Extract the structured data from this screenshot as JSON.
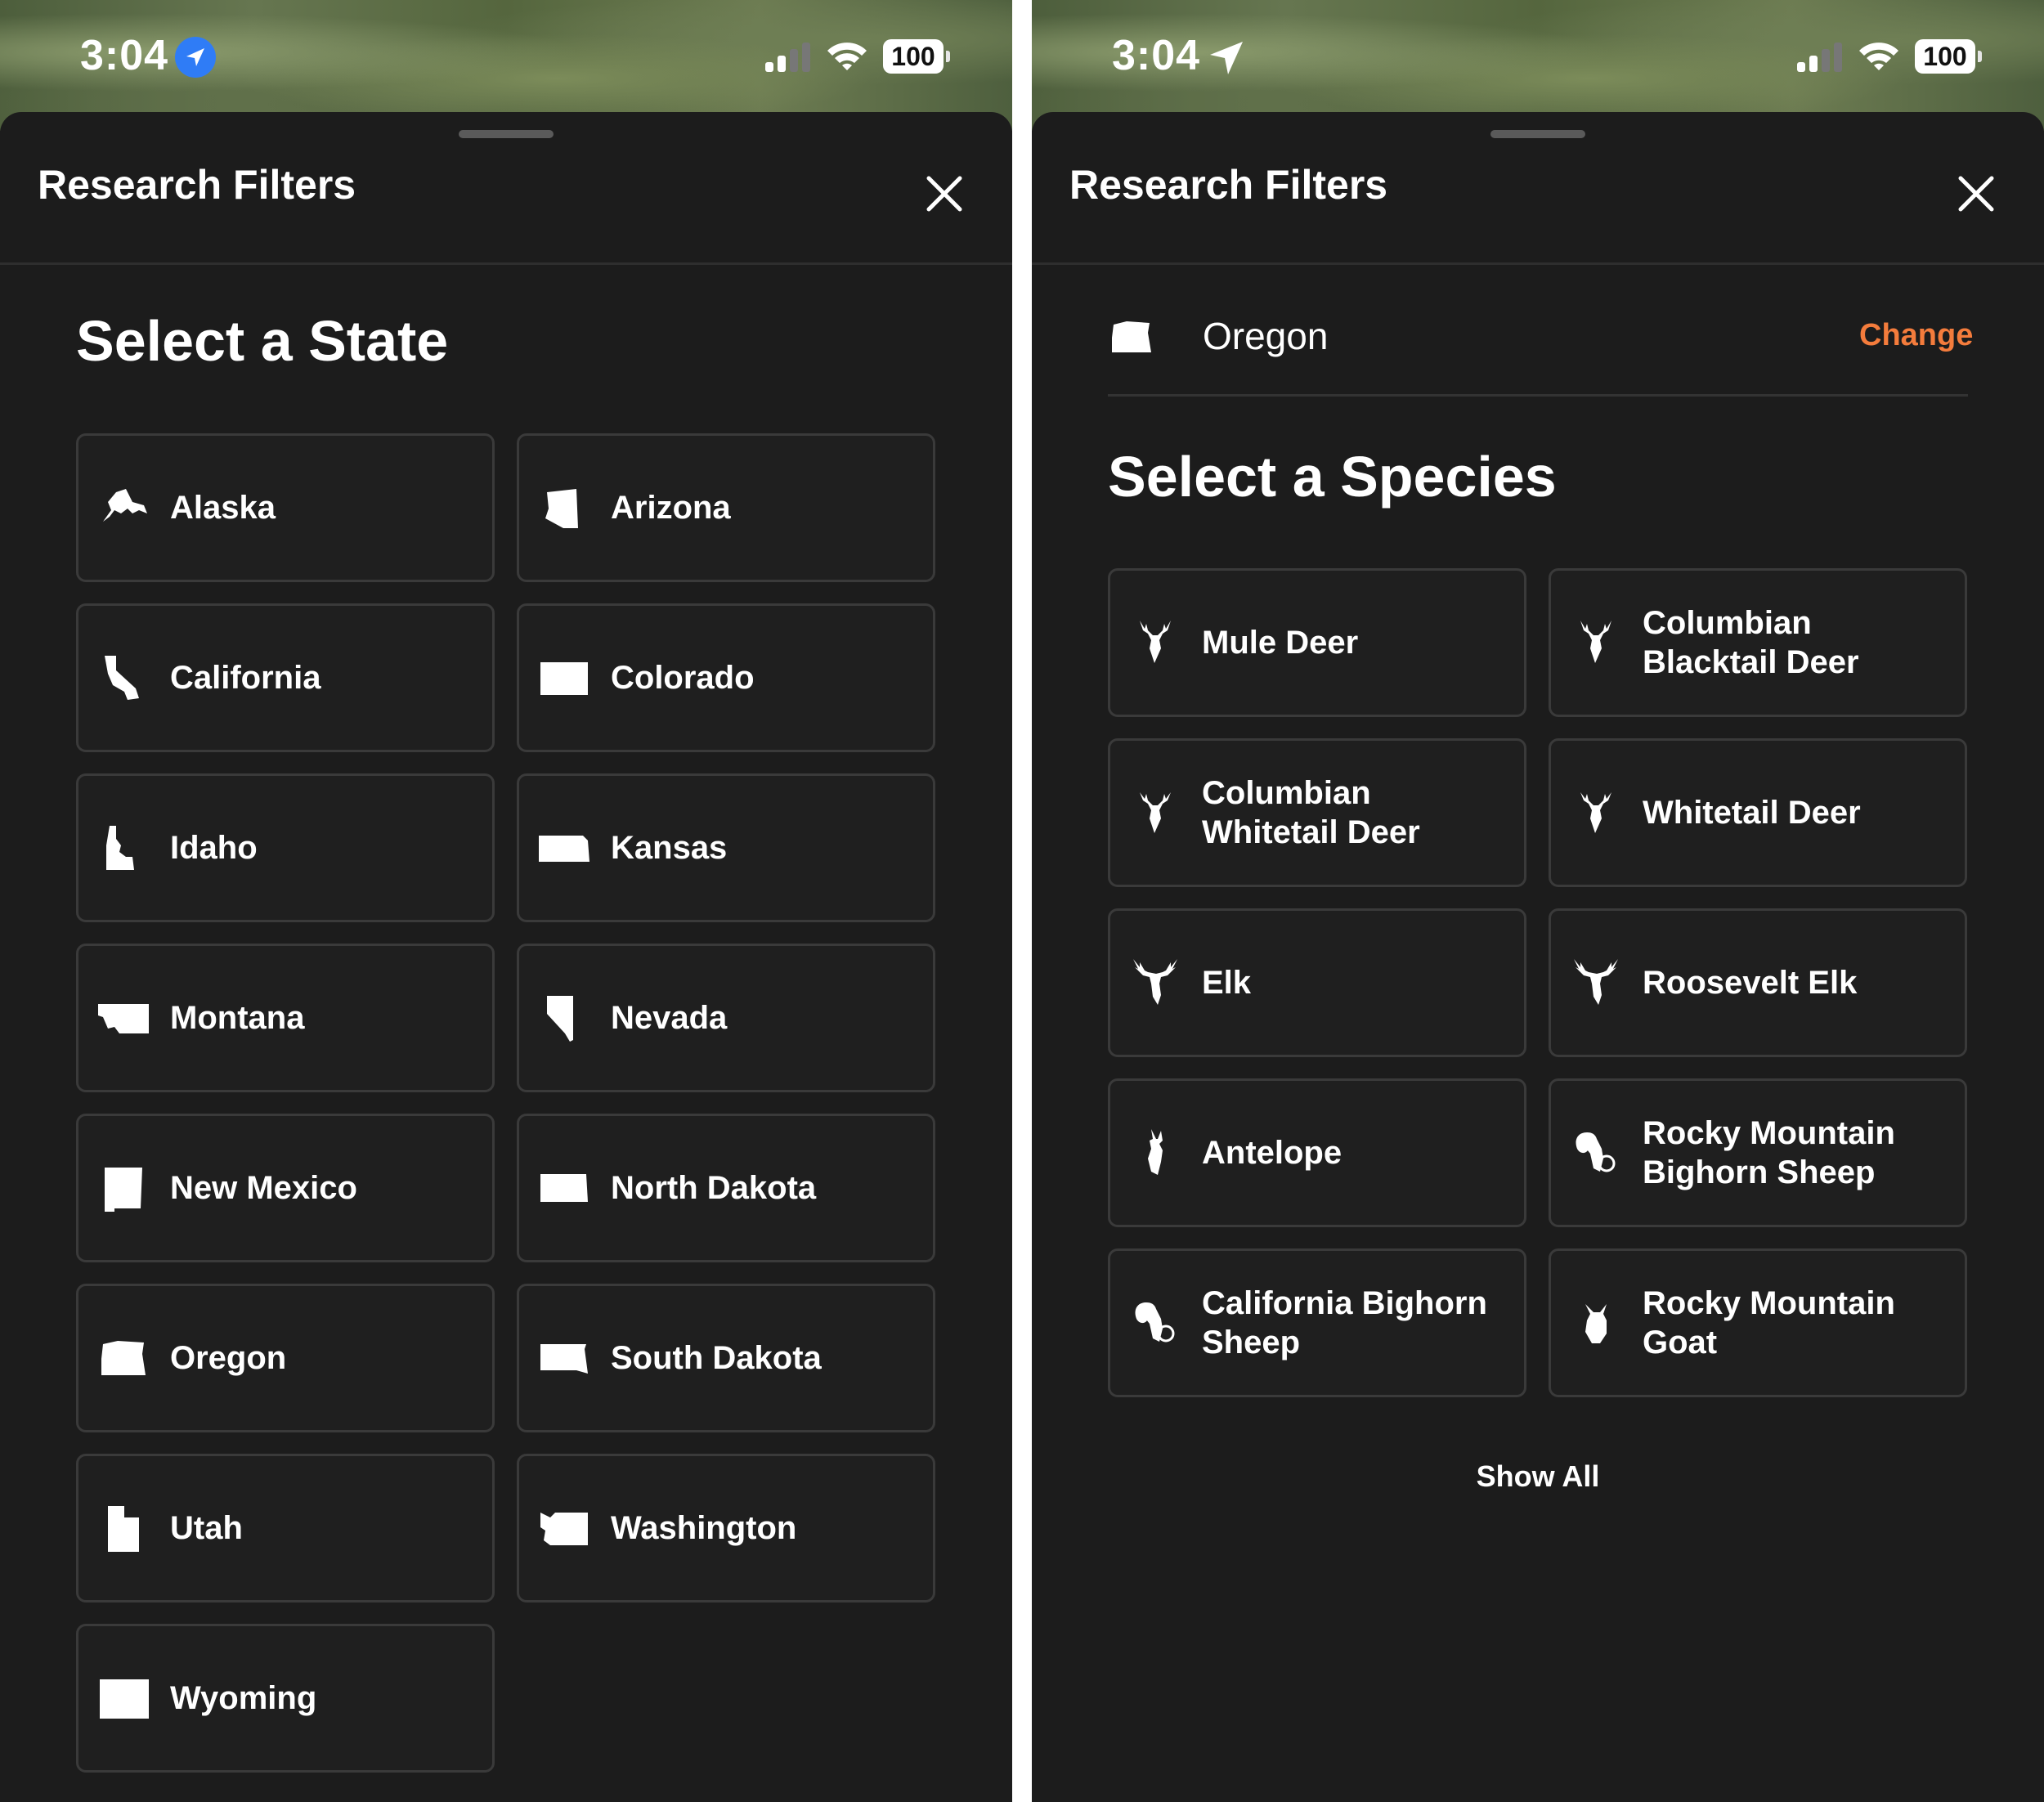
{
  "left_screen": {
    "status": {
      "time": "3:04",
      "battery": "100"
    },
    "title": "Research Filters",
    "heading": "Select a State",
    "states": [
      {
        "label": "Alaska",
        "icon": "alaska-icon"
      },
      {
        "label": "Arizona",
        "icon": "arizona-icon"
      },
      {
        "label": "California",
        "icon": "california-icon"
      },
      {
        "label": "Colorado",
        "icon": "colorado-icon"
      },
      {
        "label": "Idaho",
        "icon": "idaho-icon"
      },
      {
        "label": "Kansas",
        "icon": "kansas-icon"
      },
      {
        "label": "Montana",
        "icon": "montana-icon"
      },
      {
        "label": "Nevada",
        "icon": "nevada-icon"
      },
      {
        "label": "New Mexico",
        "icon": "new-mexico-icon"
      },
      {
        "label": "North Dakota",
        "icon": "north-dakota-icon"
      },
      {
        "label": "Oregon",
        "icon": "oregon-icon"
      },
      {
        "label": "South Dakota",
        "icon": "south-dakota-icon"
      },
      {
        "label": "Utah",
        "icon": "utah-icon"
      },
      {
        "label": "Washington",
        "icon": "washington-icon"
      },
      {
        "label": "Wyoming",
        "icon": "wyoming-icon"
      }
    ]
  },
  "right_screen": {
    "status": {
      "time": "3:04",
      "battery": "100"
    },
    "title": "Research Filters",
    "selected_state": "Oregon",
    "change_label": "Change",
    "heading": "Select a Species",
    "species": [
      {
        "label": "Mule Deer",
        "icon": "deer-icon"
      },
      {
        "label": "Columbian Blacktail Deer",
        "icon": "deer-icon"
      },
      {
        "label": "Columbian Whitetail Deer",
        "icon": "deer-icon"
      },
      {
        "label": "Whitetail Deer",
        "icon": "deer-icon"
      },
      {
        "label": "Elk",
        "icon": "elk-icon"
      },
      {
        "label": "Roosevelt Elk",
        "icon": "elk-icon"
      },
      {
        "label": "Antelope",
        "icon": "antelope-icon"
      },
      {
        "label": "Rocky Mountain Bighorn Sheep",
        "icon": "bighorn-sheep-icon"
      },
      {
        "label": "California Bighorn Sheep",
        "icon": "bighorn-sheep-icon"
      },
      {
        "label": "Rocky Mountain Goat",
        "icon": "mountain-goat-icon"
      }
    ],
    "show_all_label": "Show All"
  },
  "colors": {
    "sheet_background": "#1c1c1c",
    "tile_border": "#3a3a3a",
    "accent_orange": "#f47c3c",
    "location_blue": "#2f7cf6"
  }
}
